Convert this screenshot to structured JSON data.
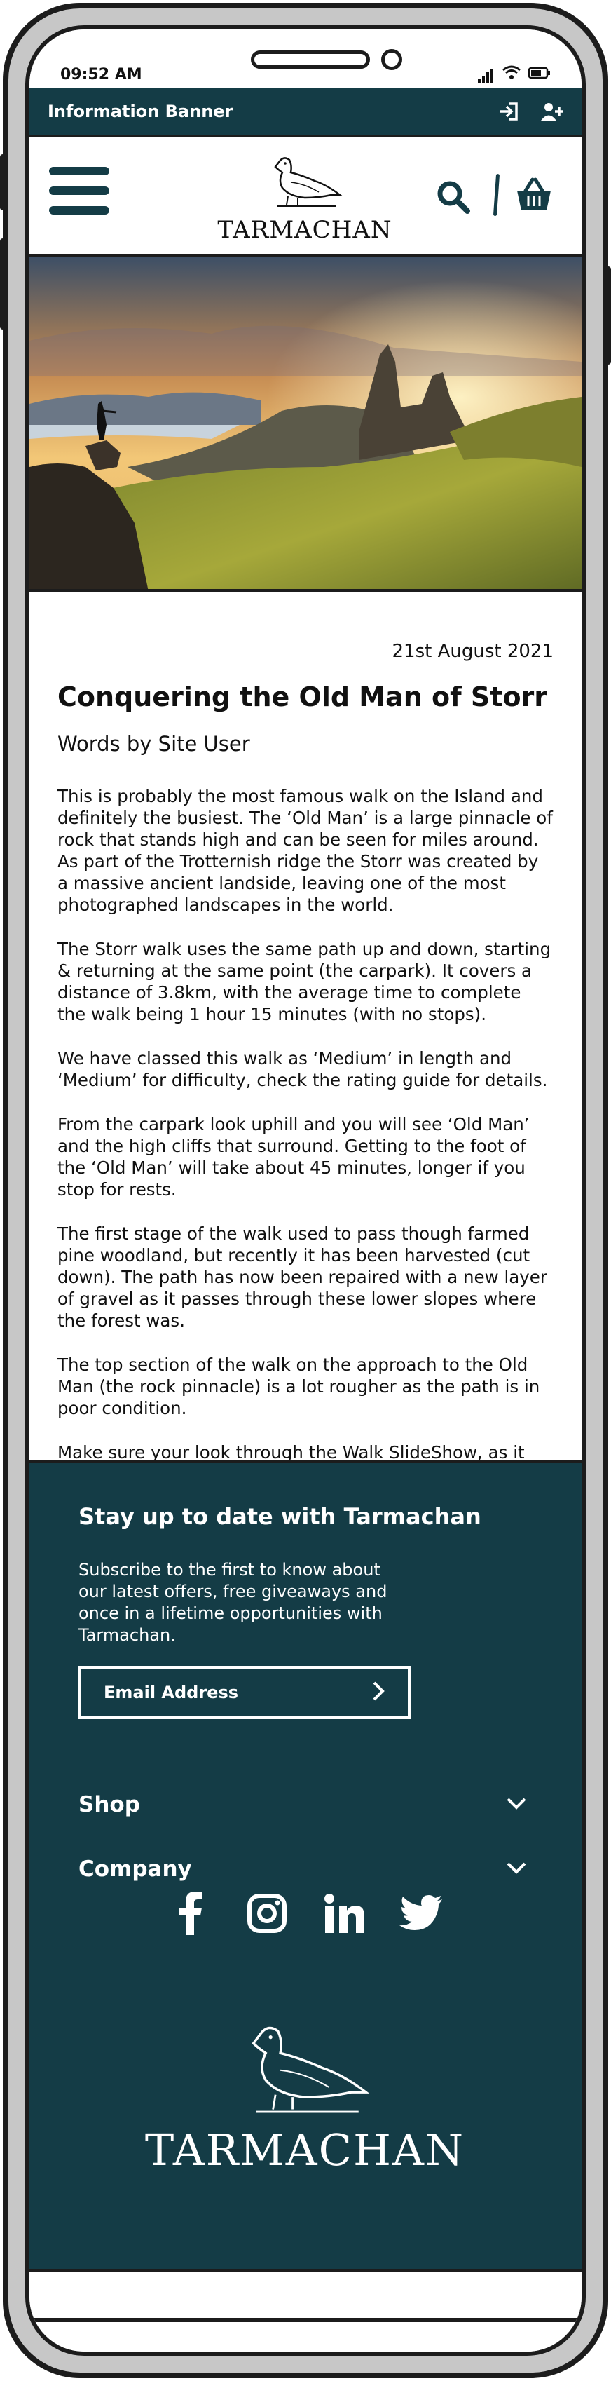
{
  "status_bar": {
    "time": "09:52 AM"
  },
  "info_banner": {
    "label": "Information Banner",
    "login_icon": "sign-in-icon",
    "register_icon": "user-plus-icon"
  },
  "header": {
    "logo_text": "TARMACHAN",
    "menu_icon": "hamburger-menu-icon",
    "search_icon": "search-icon",
    "basket_icon": "basket-icon"
  },
  "hero": {
    "description_icon": "hero-photo"
  },
  "article": {
    "date": "21st August 2021",
    "title": "Conquering the Old Man of Storr",
    "author": "Words by Site User",
    "paragraphs": [
      "This is probably the most famous walk on the Island and definitely the busiest. The ‘Old Man’ is a large pinnacle of rock that stands high and can be seen for miles around. As part of the Trotternish ridge the Storr was created by a massive ancient landside, leaving one of the most photographed landscapes in the world.",
      "The Storr walk uses the same path up and down, starting & returning at the same point (the carpark). It covers a distance of 3.8km, with the average time to complete the walk being 1 hour 15 minutes (with no stops).",
      "We have classed this walk as ‘Medium’ in length and ‘Medium’ for difficulty, check the rating guide for details.",
      "From the carpark look uphill and you will see ‘Old Man’ and the high cliffs that surround. Getting to the foot of the ‘Old Man’ will take about 45 minutes, longer if you stop for rests.",
      "The first stage of the walk used to pass though farmed pine woodland, but recently it has been harvested (cut down). The path has now been repaired with a new layer of gravel as it passes through these lower slopes where the forest was.",
      "The top section of the walk on the approach to the Old Man (the rock pinnacle) is a lot rougher as the path is in poor condition.",
      "Make sure your look through the Walk SlideShow, as it give a step by step account of what you will encounter."
    ]
  },
  "footer": {
    "newsletter_title": "Stay up to date with Tarmachan",
    "newsletter_text": "Subscribe to the first to know about our latest offers, free giveaways and once in a lifetime opportunities with Tarmachan.",
    "email_placeholder": "Email Address",
    "accordions": [
      {
        "label": "Shop"
      },
      {
        "label": "Company"
      }
    ],
    "socials": [
      "facebook-icon",
      "instagram-icon",
      "linkedin-icon",
      "twitter-icon"
    ],
    "logo_text": "TARMACHAN"
  },
  "colors": {
    "brand_dark": "#143c46",
    "frame": "#1c1c1c",
    "frame_gray": "#c7c7c7"
  }
}
